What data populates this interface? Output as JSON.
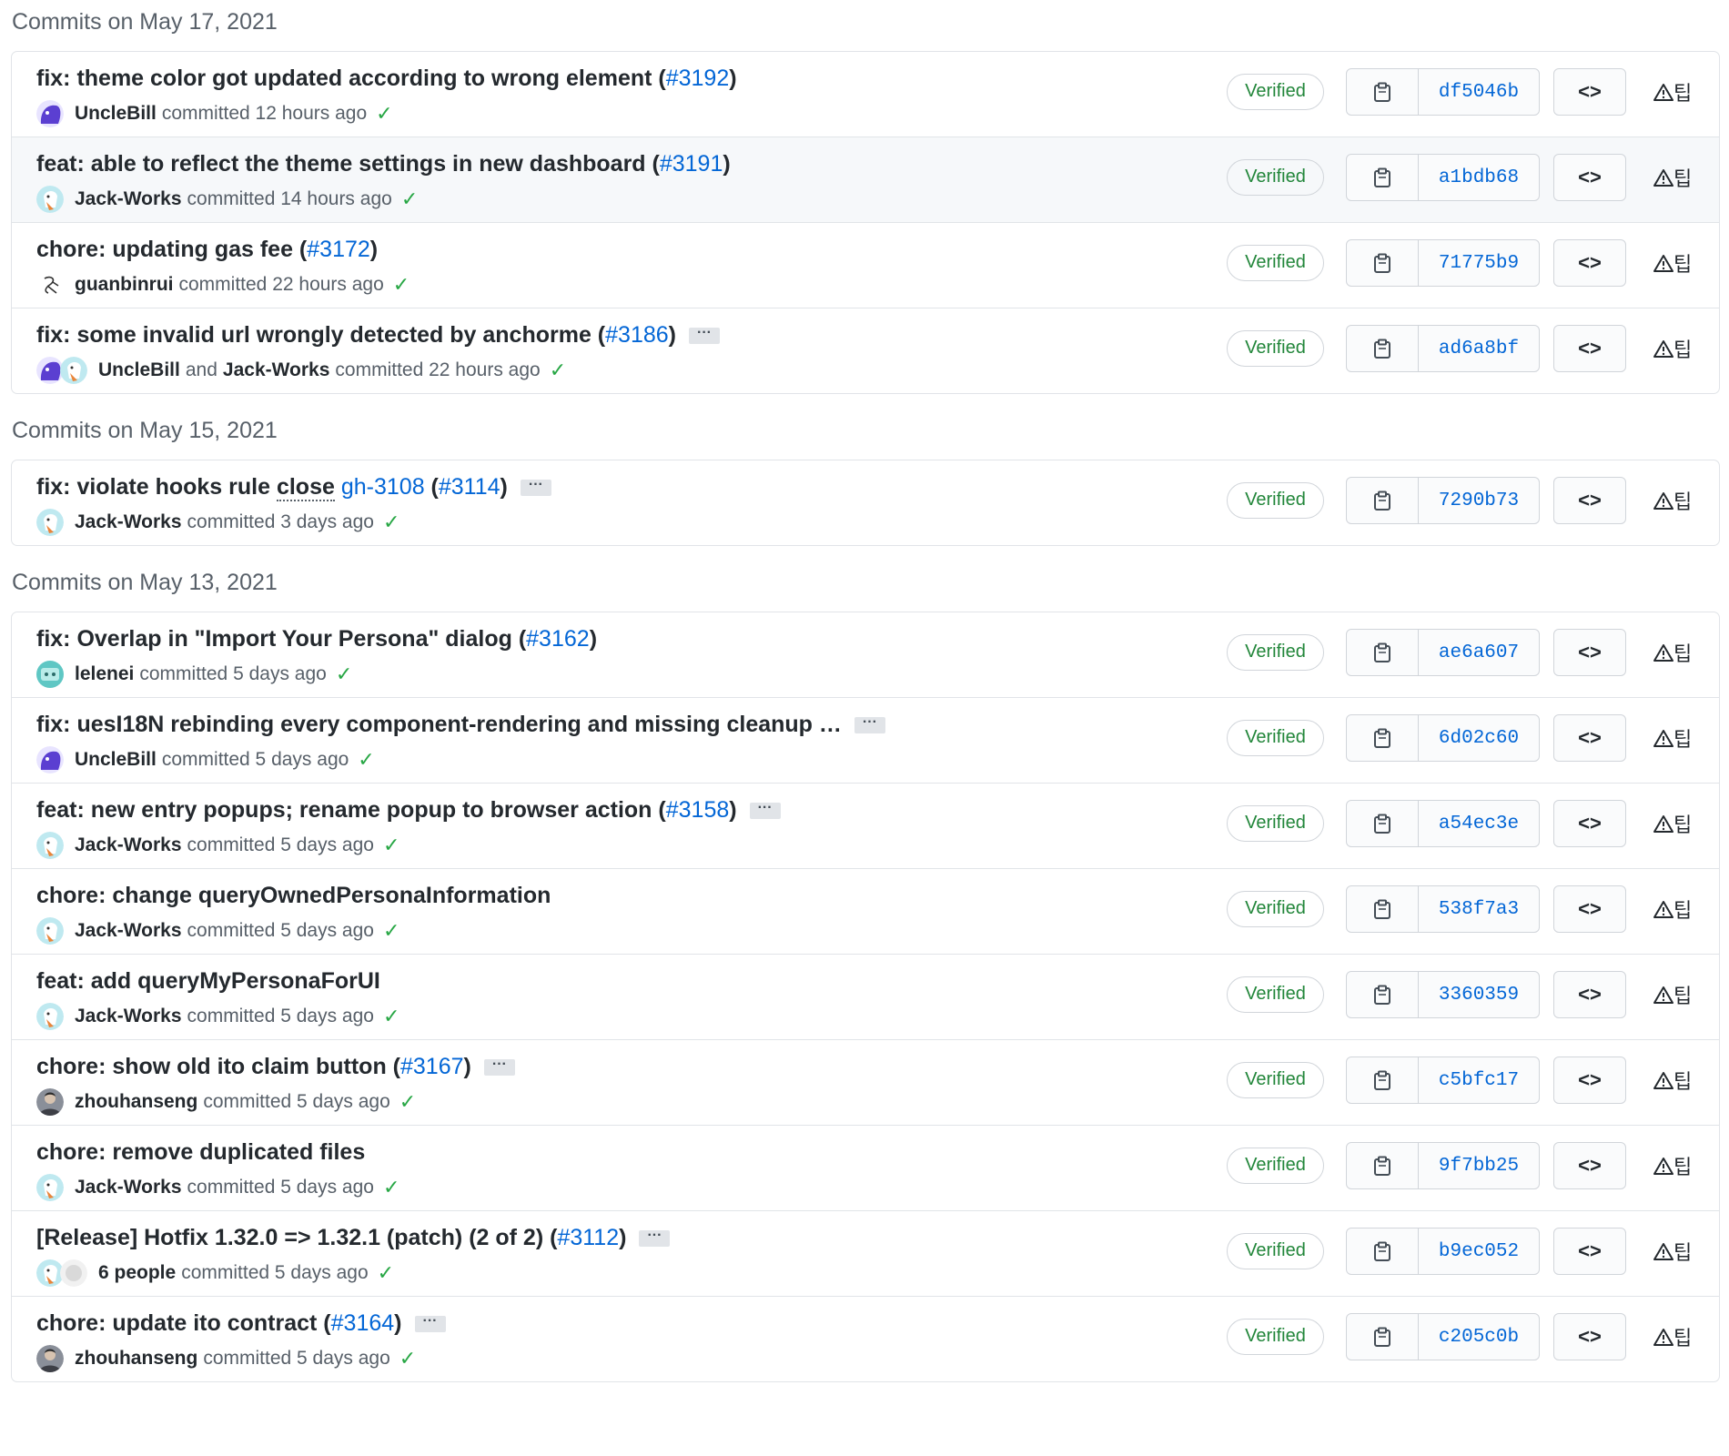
{
  "groups": [
    {
      "header": "Commits on May 17, 2021",
      "commits": [
        {
          "message": "fix: theme color got updated according to wrong element (",
          "issue": "#3192",
          "tail": ")",
          "more": false,
          "authors": [
            "UncleBill"
          ],
          "avatars": [
            "purple"
          ],
          "connector": "",
          "action": "committed 12 hours ago",
          "verified": "Verified",
          "sha": "df5046b",
          "highlighted": false
        },
        {
          "message": "feat: able to reflect the theme settings in new dashboard (",
          "issue": "#3191",
          "tail": ")",
          "more": false,
          "authors": [
            "Jack-Works"
          ],
          "avatars": [
            "teal"
          ],
          "connector": "",
          "action": "committed 14 hours ago",
          "verified": "Verified",
          "sha": "a1bdb68",
          "highlighted": true
        },
        {
          "message": "chore: updating gas fee (",
          "issue": "#3172",
          "tail": ")",
          "more": false,
          "authors": [
            "guanbinrui"
          ],
          "avatars": [
            "sketch"
          ],
          "connector": "",
          "action": "committed 22 hours ago",
          "verified": "Verified",
          "sha": "71775b9",
          "highlighted": false
        },
        {
          "message": "fix: some invalid url wrongly detected by anchorme (",
          "issue": "#3186",
          "tail": ")",
          "more": true,
          "authors": [
            "UncleBill",
            "Jack-Works"
          ],
          "avatars": [
            "purple",
            "teal"
          ],
          "connector": "and",
          "action": "committed 22 hours ago",
          "verified": "Verified",
          "sha": "ad6a8bf",
          "highlighted": false
        }
      ]
    },
    {
      "header": "Commits on May 15, 2021",
      "commits": [
        {
          "message": "fix: violate hooks rule ",
          "underline": "close",
          "plain_link": "gh-3108",
          "mid": " (",
          "issue": "#3114",
          "tail": ")",
          "more": true,
          "authors": [
            "Jack-Works"
          ],
          "avatars": [
            "teal"
          ],
          "connector": "",
          "action": "committed 3 days ago",
          "verified": "Verified",
          "sha": "7290b73",
          "highlighted": false
        }
      ]
    },
    {
      "header": "Commits on May 13, 2021",
      "commits": [
        {
          "message": "fix: Overlap in \"Import Your Persona\" dialog (",
          "issue": "#3162",
          "tail": ")",
          "more": false,
          "authors": [
            "lelenei"
          ],
          "avatars": [
            "cyan"
          ],
          "connector": "",
          "action": "committed 5 days ago",
          "verified": "Verified",
          "sha": "ae6a607",
          "highlighted": false
        },
        {
          "message": "fix: uesI18N rebinding every component-rendering and missing cleanup …",
          "issue": "",
          "tail": "",
          "more": true,
          "authors": [
            "UncleBill"
          ],
          "avatars": [
            "purple"
          ],
          "connector": "",
          "action": "committed 5 days ago",
          "verified": "Verified",
          "sha": "6d02c60",
          "highlighted": false
        },
        {
          "message": "feat: new entry popups; rename popup to browser action (",
          "issue": "#3158",
          "tail": ")",
          "more": true,
          "authors": [
            "Jack-Works"
          ],
          "avatars": [
            "teal"
          ],
          "connector": "",
          "action": "committed 5 days ago",
          "verified": "Verified",
          "sha": "a54ec3e",
          "highlighted": false
        },
        {
          "message": "chore: change queryOwnedPersonaInformation",
          "issue": "",
          "tail": "",
          "more": false,
          "authors": [
            "Jack-Works"
          ],
          "avatars": [
            "teal"
          ],
          "connector": "",
          "action": "committed 5 days ago",
          "verified": "Verified",
          "sha": "538f7a3",
          "highlighted": false
        },
        {
          "message": "feat: add queryMyPersonaForUI",
          "issue": "",
          "tail": "",
          "more": false,
          "authors": [
            "Jack-Works"
          ],
          "avatars": [
            "teal"
          ],
          "connector": "",
          "action": "committed 5 days ago",
          "verified": "Verified",
          "sha": "3360359",
          "highlighted": false
        },
        {
          "message": "chore: show old ito claim button (",
          "issue": "#3167",
          "tail": ")",
          "more": true,
          "authors": [
            "zhouhanseng"
          ],
          "avatars": [
            "photo"
          ],
          "connector": "",
          "action": "committed 5 days ago",
          "verified": "Verified",
          "sha": "c5bfc17",
          "highlighted": false
        },
        {
          "message": "chore: remove duplicated files",
          "issue": "",
          "tail": "",
          "more": false,
          "authors": [
            "Jack-Works"
          ],
          "avatars": [
            "teal"
          ],
          "connector": "",
          "action": "committed 5 days ago",
          "verified": "Verified",
          "sha": "9f7bb25",
          "highlighted": false
        },
        {
          "message": "[Release] Hotfix 1.32.0 => 1.32.1 (patch) (2 of 2) (",
          "issue": "#3112",
          "tail": ")",
          "more": true,
          "authors": [
            "6 people"
          ],
          "avatars": [
            "teal",
            "white"
          ],
          "connector": "",
          "action": "committed 5 days ago",
          "verified": "Verified",
          "sha": "b9ec052",
          "highlighted": false
        },
        {
          "message": "chore: update ito contract (",
          "issue": "#3164",
          "tail": ")",
          "more": true,
          "authors": [
            "zhouhanseng"
          ],
          "avatars": [
            "photo"
          ],
          "connector": "",
          "action": "committed 5 days ago",
          "verified": "Verified",
          "sha": "c205c0b",
          "highlighted": false
        }
      ]
    }
  ],
  "icons": {
    "copy": "clipboard-icon",
    "browse": "code-icon",
    "flag": "alert-triangle-icon",
    "check": "check-icon",
    "more": "ellipsis-icon"
  },
  "glyphs": {
    "check": "✓",
    "browse": "<>",
    "flag_extra": "팁",
    "more": "···"
  },
  "colors": {
    "verified": "#22863a",
    "link": "#0366d6",
    "check": "#28a745",
    "highlight_row": "#f6f8fa"
  }
}
